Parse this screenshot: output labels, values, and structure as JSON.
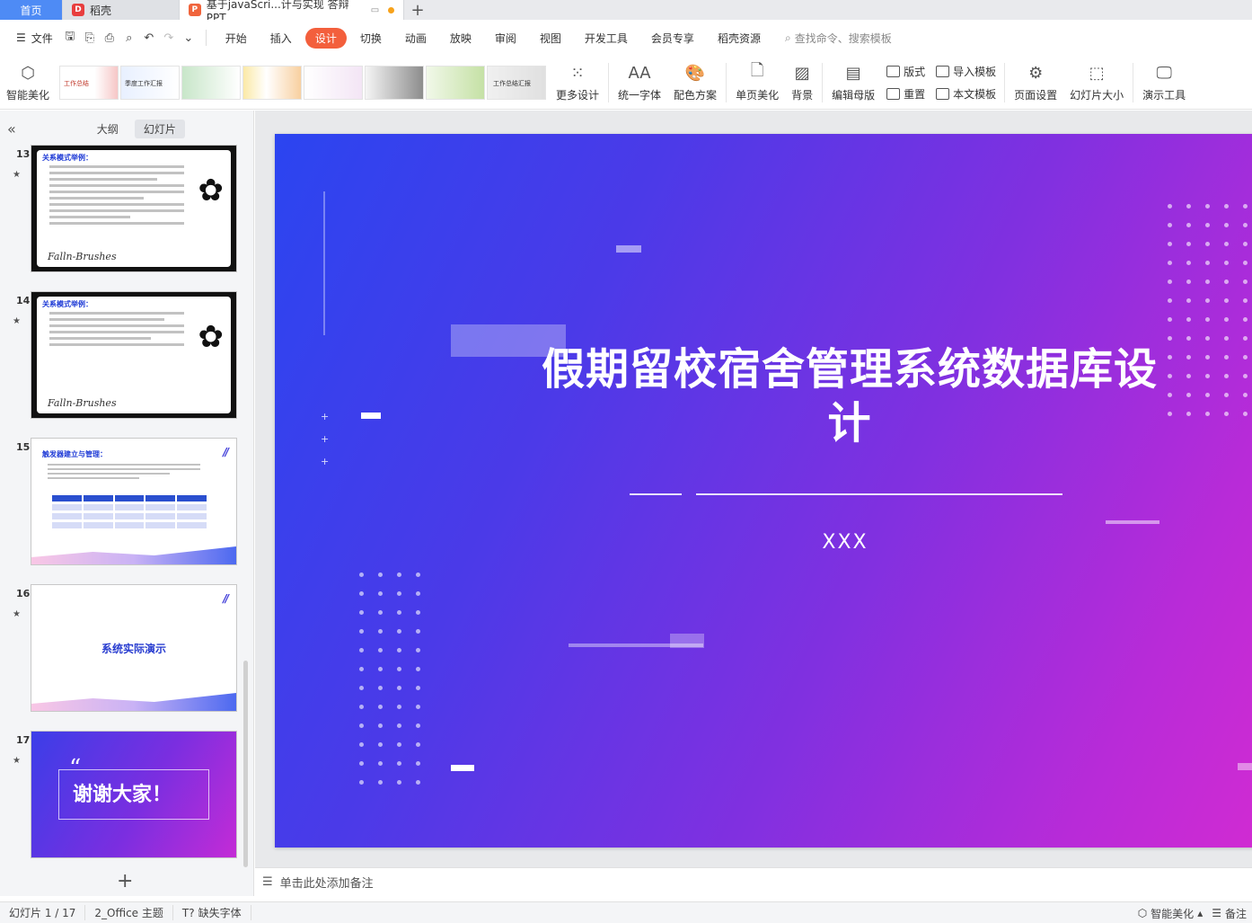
{
  "tabs": {
    "home": "首页",
    "shell": "稻壳",
    "doc": "基于javaScri...计与实现 答辩PPT",
    "new_tab": "+"
  },
  "menu": {
    "file": "文件",
    "items": [
      "开始",
      "插入",
      "设计",
      "切换",
      "动画",
      "放映",
      "审阅",
      "视图",
      "开发工具",
      "会员专享",
      "稻壳资源"
    ],
    "active": "设计",
    "search_placeholder": "查找命令、搜索模板"
  },
  "ribbon": {
    "smart_beautify": "智能美化",
    "more_design": "更多设计",
    "unify_font": "统一字体",
    "color_scheme": "配色方案",
    "single_page_beautify": "单页美化",
    "background": "背景",
    "edit_master": "编辑母版",
    "layout": "版式",
    "reset": "重置",
    "import_template": "导入模板",
    "text_template": "本文模板",
    "page_setup": "页面设置",
    "slide_size": "幻灯片大小",
    "presentation_tools": "演示工具",
    "theme_labels": [
      "工作总结",
      "季度工作汇报",
      "",
      "",
      "",
      "",
      "",
      "工作总结汇报"
    ]
  },
  "left_panel": {
    "collapse": "«",
    "tab_outline": "大纲",
    "tab_slides": "幻灯片",
    "add_slide": "+",
    "slides": [
      {
        "num": "13",
        "title": "关系模式举例：",
        "signature": "Falln-Brushes"
      },
      {
        "num": "14",
        "title": "关系模式举例：",
        "signature": "Falln-Brushes"
      },
      {
        "num": "15",
        "title": "触发器建立与管理："
      },
      {
        "num": "16",
        "title": "系统实际演示"
      },
      {
        "num": "17",
        "title": "谢谢大家！"
      }
    ]
  },
  "slide": {
    "title": "假期留校宿舍管理系统数据库设计",
    "subtitle": "XXX"
  },
  "notes": {
    "placeholder": "单击此处添加备注"
  },
  "status": {
    "slide_counter": "幻灯片 1 / 17",
    "theme": "2_Office 主题",
    "missing_font": "缺失字体",
    "smart_beautify": "智能美化",
    "notes": "备注"
  },
  "colors": {
    "accent": "#f35f3c",
    "home_tab": "#4e8bf5",
    "slide_gradient_start": "#2b45f0",
    "slide_gradient_end": "#d12bd2"
  }
}
